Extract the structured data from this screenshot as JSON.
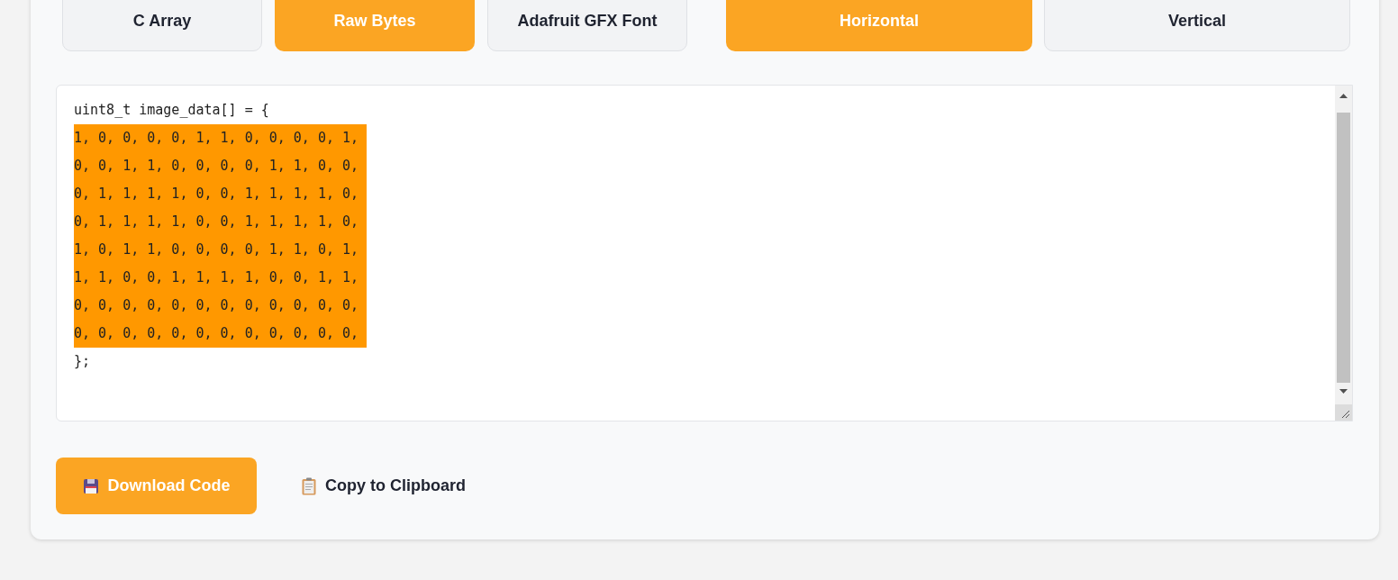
{
  "format_options": [
    {
      "label": "C Array",
      "selected": false
    },
    {
      "label": "Raw Bytes",
      "selected": true
    },
    {
      "label": "Adafruit GFX Font",
      "selected": false
    }
  ],
  "orientation_options": [
    {
      "label": "Horizontal",
      "selected": true
    },
    {
      "label": "Vertical",
      "selected": false
    }
  ],
  "code": {
    "header": "uint8_t image_data[] = {",
    "selected": true,
    "rows": [
      "1, 0, 0, 0, 0, 1, 1, 0, 0, 0, 0, 1,",
      "0, 0, 1, 1, 0, 0, 0, 0, 1, 1, 0, 0,",
      "0, 1, 1, 1, 1, 0, 0, 1, 1, 1, 1, 0,",
      "0, 1, 1, 1, 1, 0, 0, 1, 1, 1, 1, 0,",
      "1, 0, 1, 1, 0, 0, 0, 0, 1, 1, 0, 1,",
      "1, 1, 0, 0, 1, 1, 1, 1, 0, 0, 1, 1,",
      "0, 0, 0, 0, 0, 0, 0, 0, 0, 0, 0, 0,",
      "0, 0, 0, 0, 0, 0, 0, 0, 0, 0, 0, 0,"
    ],
    "footer": "};"
  },
  "actions": [
    {
      "kind": "primary",
      "label": "Download Code"
    },
    {
      "kind": "plain",
      "label": "Copy to Clipboard"
    }
  ]
}
